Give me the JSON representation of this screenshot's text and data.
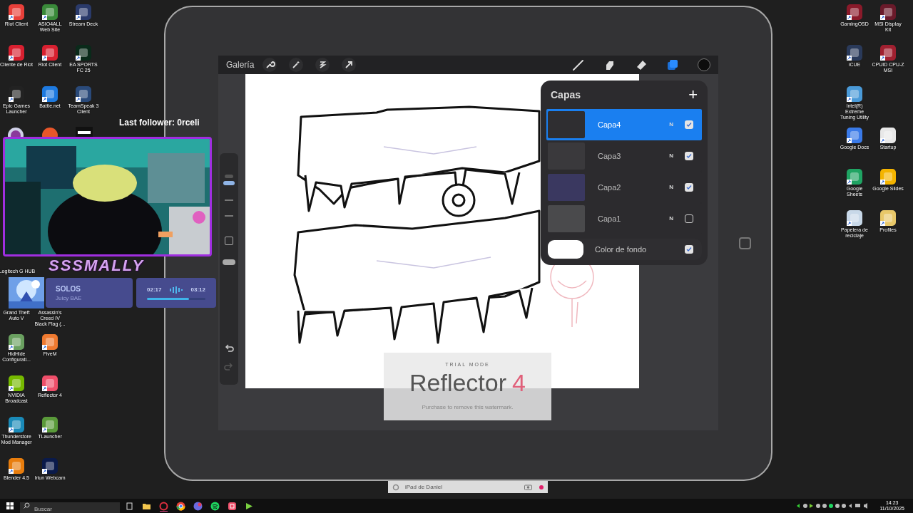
{
  "desktop_icons": [
    {
      "label": "Riot Client"
    },
    {
      "label": "ASIO4ALL Web Site"
    },
    {
      "label": "Stream Deck"
    },
    {
      "label": "Cliente de Riot"
    },
    {
      "label": "Riot Client"
    },
    {
      "label": "EA SPORTS FC 25"
    },
    {
      "label": "Epic Games Launcher"
    },
    {
      "label": "Battle.net"
    },
    {
      "label": "TeamSpeak 3 Client"
    },
    {
      "label": "Logitech G HUB"
    },
    {
      "label": "Grand Theft Auto V"
    },
    {
      "label": "Assassin's Creed IV Black Flag (..."
    },
    {
      "label": "HidHide Configurati..."
    },
    {
      "label": "FiveM"
    },
    {
      "label": "NVIDIA Broadcast"
    },
    {
      "label": "Reflector 4"
    },
    {
      "label": "Thunderstore Mod Manager"
    },
    {
      "label": "TLauncher"
    },
    {
      "label": "Blender 4.5"
    },
    {
      "label": "Iriun Webcam"
    },
    {
      "label": "GamingOSD"
    },
    {
      "label": "MSI Display Kit"
    },
    {
      "label": "iCUE"
    },
    {
      "label": "CPUID CPU-Z MSI"
    },
    {
      "label": "Intel(R) Extreme Tuning Utility"
    },
    {
      "label": "Google Docs"
    },
    {
      "label": "Startup"
    },
    {
      "label": "Google Sheets"
    },
    {
      "label": "Google Slides"
    },
    {
      "label": "Papelera de reciclaje"
    },
    {
      "label": "Profiles"
    }
  ],
  "stream_overlay": {
    "last_follower": "Last follower: 0rceli",
    "streamer_name": "SSSMALLY",
    "now_playing": {
      "title": "SOLOS",
      "artist": "Juicy BAE",
      "elapsed": "02:17",
      "duration": "03:12",
      "level": 0.72
    }
  },
  "procreate": {
    "gallery": "Galería",
    "layers_panel": {
      "title": "Capas",
      "add": "+",
      "layers": [
        {
          "name": "Capa4",
          "blend": "N",
          "visible": true,
          "selected": true
        },
        {
          "name": "Capa3",
          "blend": "N",
          "visible": true,
          "selected": false
        },
        {
          "name": "Capa2",
          "blend": "N",
          "visible": true,
          "selected": false
        },
        {
          "name": "Capa1",
          "blend": "N",
          "visible": false,
          "selected": false
        }
      ],
      "background": {
        "name": "Color de fondo",
        "visible": true
      }
    }
  },
  "reflector_watermark": {
    "mode": "TRIAL MODE",
    "app_name": "Reflector",
    "version": "4",
    "note": "Purchase to remove this watermark."
  },
  "device_bar": {
    "name": "iPad de Daniel"
  },
  "taskbar": {
    "search_placeholder": "Buscar",
    "time": "14:23",
    "date": "11/10/2025"
  }
}
